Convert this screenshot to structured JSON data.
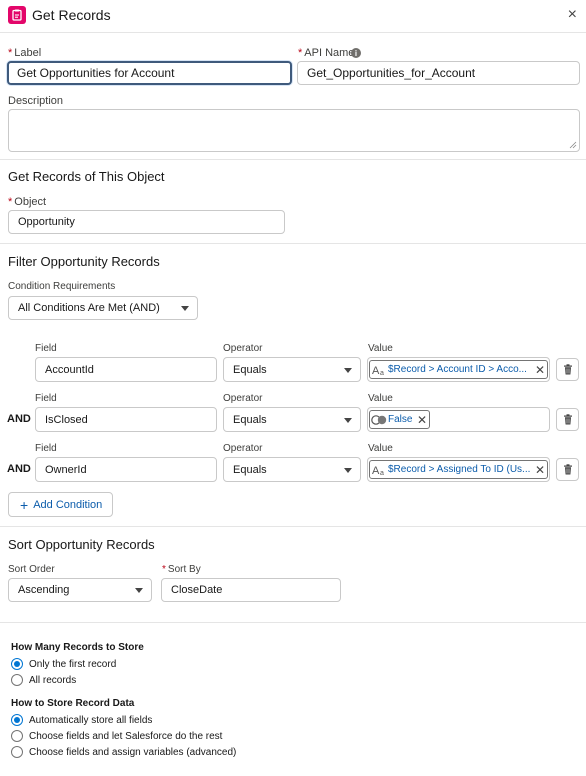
{
  "header": {
    "title": "Get Records",
    "icon": "get-records-icon",
    "close": "×"
  },
  "label_field": {
    "label": "Label",
    "value": "Get Opportunities for Account"
  },
  "api_field": {
    "label": "API Name",
    "value": "Get_Opportunities_for_Account"
  },
  "description": {
    "label": "Description",
    "value": ""
  },
  "object_section": {
    "title": "Get Records of This Object",
    "object_label": "Object",
    "object_value": "Opportunity"
  },
  "filter_section": {
    "title": "Filter Opportunity Records",
    "condition_label": "Condition Requirements",
    "condition_value": "All Conditions Are Met (AND)",
    "rows": [
      {
        "connector": "",
        "field_label": "Field",
        "field": "AccountId",
        "operator_label": "Operator",
        "operator": "Equals",
        "value_label": "Value",
        "value": "$Record > Account ID > Acco...",
        "value_icon": "text-type-icon"
      },
      {
        "connector": "AND",
        "field_label": "Field",
        "field": "IsClosed",
        "operator_label": "Operator",
        "operator": "Equals",
        "value_label": "Value",
        "value": "False",
        "value_icon": "boolean-toggle-icon"
      },
      {
        "connector": "AND",
        "field_label": "Field",
        "field": "OwnerId",
        "operator_label": "Operator",
        "operator": "Equals",
        "value_label": "Value",
        "value": "$Record > Assigned To ID (Us...",
        "value_icon": "text-type-icon"
      }
    ],
    "add_condition": "Add Condition"
  },
  "sort_section": {
    "title": "Sort Opportunity Records",
    "order_label": "Sort Order",
    "order_value": "Ascending",
    "sortby_label": "Sort By",
    "sortby_value": "CloseDate"
  },
  "store_count": {
    "title": "How Many Records to Store",
    "options": [
      "Only the first record",
      "All records"
    ],
    "selected": 0
  },
  "store_data": {
    "title": "How to Store Record Data",
    "options": [
      "Automatically store all fields",
      "Choose fields and let Salesforce do the rest",
      "Choose fields and assign variables (advanced)"
    ],
    "selected": 0
  },
  "colors": {
    "accent": "#0176d3",
    "link": "#0b5cab",
    "required": "#ba0517",
    "brand_icon": "#e3066a"
  }
}
